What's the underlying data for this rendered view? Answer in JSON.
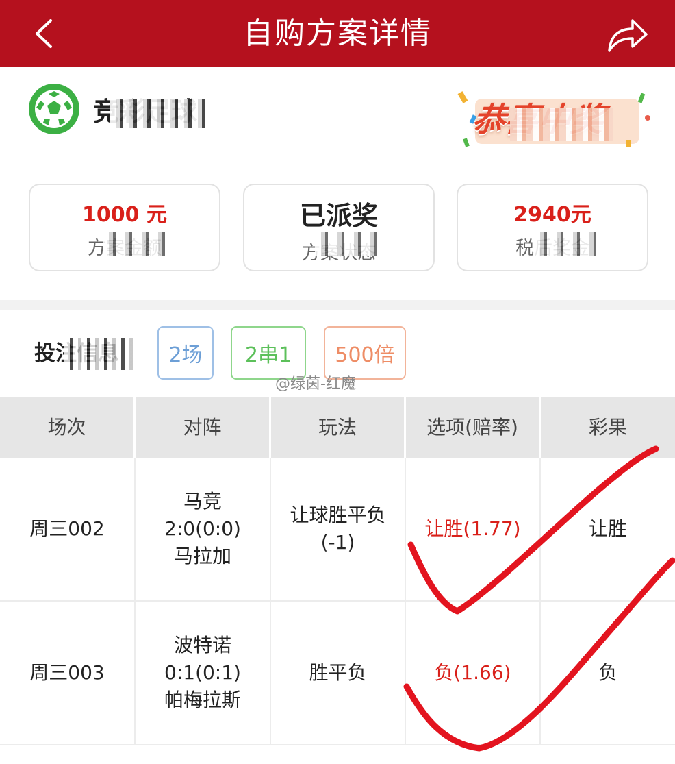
{
  "header": {
    "title": "自购方案详情"
  },
  "lottery": {
    "name": "竞彩足球"
  },
  "badge": {
    "text": "恭喜中奖"
  },
  "summary": {
    "cards": [
      {
        "value": "1000 元",
        "label": "方案金额"
      },
      {
        "value": "已派奖",
        "label": "方案状态"
      },
      {
        "value": "2940元",
        "label": "税后奖金"
      }
    ]
  },
  "bet": {
    "label": "投注信息",
    "tags": [
      "2场",
      "2串1",
      "500倍"
    ]
  },
  "watermark": "@绿茵-红魔",
  "colors": {
    "header": "#b5111e",
    "accent_red": "#d9201a",
    "tag_blue": "#6d9fd6",
    "tag_green": "#5cc05a",
    "tag_orange": "#ee8d66"
  },
  "table": {
    "headers": [
      "场次",
      "对阵",
      "玩法",
      "选项(赔率)",
      "彩果"
    ],
    "rows": [
      {
        "match_no": "周三002",
        "home": "马竞",
        "score": "2:0(0:0)",
        "away": "马拉加",
        "play": "让球胜平负",
        "play_note": "(-1)",
        "option": "让胜(1.77)",
        "result": "让胜"
      },
      {
        "match_no": "周三003",
        "home": "波特诺",
        "score": "0:1(0:1)",
        "away": "帕梅拉斯",
        "play": "胜平负",
        "play_note": "",
        "option": "负(1.66)",
        "result": "负"
      }
    ]
  }
}
